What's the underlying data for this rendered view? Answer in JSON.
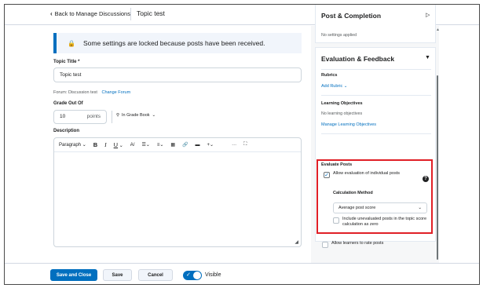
{
  "topbar": {
    "back_label": "Back to Manage Discussions",
    "title": "Topic test"
  },
  "main": {
    "lock_message": "Some settings are locked because posts have been received.",
    "topic_title_label": "Topic Title *",
    "topic_title_value": "Topic test",
    "forum_text": "Forum: Discussion test",
    "change_forum_label": "Change Forum",
    "grade_out_of_label": "Grade Out Of",
    "grade_value": "10",
    "points_label": "points",
    "in_grade_book_label": "In Grade Book",
    "description_label": "Description",
    "toolbar": {
      "paragraph": "Paragraph",
      "bold": "B",
      "italic": "I",
      "underline": "U",
      "more": "···"
    }
  },
  "side": {
    "post_completion": {
      "title": "Post & Completion",
      "status": "No settings applied"
    },
    "eval": {
      "title": "Evaluation & Feedback",
      "rubrics_label": "Rubrics",
      "add_rubric": "Add Rubric",
      "learning_objectives_label": "Learning Objectives",
      "no_objectives": "No learning objectives",
      "manage_objectives": "Manage Learning Objectives",
      "evaluate_posts_label": "Evaluate Posts",
      "allow_eval_label": "Allow evaluation of individual posts",
      "allow_eval_checked": true,
      "calc_method_label": "Calculation Method",
      "calc_method_value": "Average post score",
      "include_unevaluated_label": "Include unevaluated posts in the topic score calculation as zero",
      "include_unevaluated_checked": false,
      "allow_rate_label": "Allow learners to rate posts",
      "allow_rate_checked": false
    }
  },
  "footer": {
    "save_close": "Save and Close",
    "save": "Save",
    "cancel": "Cancel",
    "visible_label": "Visible",
    "visible_on": true
  },
  "colors": {
    "accent": "#006fbf",
    "highlight": "#e01f26"
  }
}
